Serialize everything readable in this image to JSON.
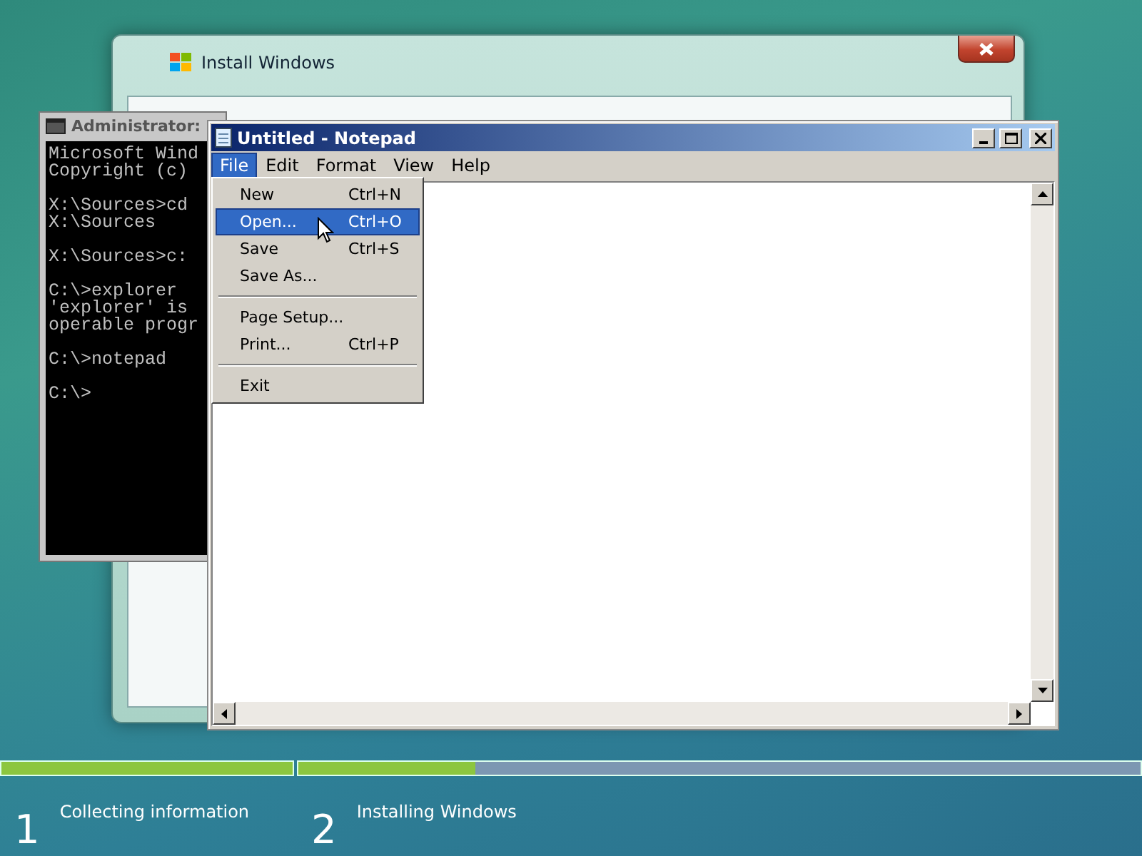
{
  "installer": {
    "title": "Install Windows"
  },
  "console": {
    "title": "Administrator:",
    "blocks": [
      [
        "Microsoft Wind",
        "Copyright (c)"
      ],
      [
        "X:\\Sources>cd",
        "X:\\Sources"
      ],
      [
        "X:\\Sources>c:"
      ],
      [
        "C:\\>explorer",
        "'explorer' is",
        "operable progr"
      ],
      [
        "C:\\>notepad"
      ],
      [
        "C:\\>"
      ]
    ]
  },
  "notepad": {
    "title": "Untitled - Notepad",
    "menus": [
      {
        "label": "File",
        "selected": true
      },
      {
        "label": "Edit",
        "selected": false
      },
      {
        "label": "Format",
        "selected": false
      },
      {
        "label": "View",
        "selected": false
      },
      {
        "label": "Help",
        "selected": false
      }
    ],
    "dropdown": [
      [
        {
          "label": "New",
          "shortcut": "Ctrl+N",
          "selected": false
        },
        {
          "label": "Open...",
          "shortcut": "Ctrl+O",
          "selected": true
        },
        {
          "label": "Save",
          "shortcut": "Ctrl+S",
          "selected": false
        },
        {
          "label": "Save As...",
          "selected": false
        }
      ],
      [
        {
          "label": "Page Setup...",
          "selected": false
        },
        {
          "label": "Print...",
          "shortcut": "Ctrl+P",
          "selected": false
        }
      ],
      [
        {
          "label": "Exit",
          "selected": false
        }
      ]
    ]
  },
  "steps": [
    {
      "number": "1",
      "label": "Collecting information",
      "level": 1
    },
    {
      "number": "2",
      "label": "Installing Windows",
      "level": 0.21
    }
  ]
}
